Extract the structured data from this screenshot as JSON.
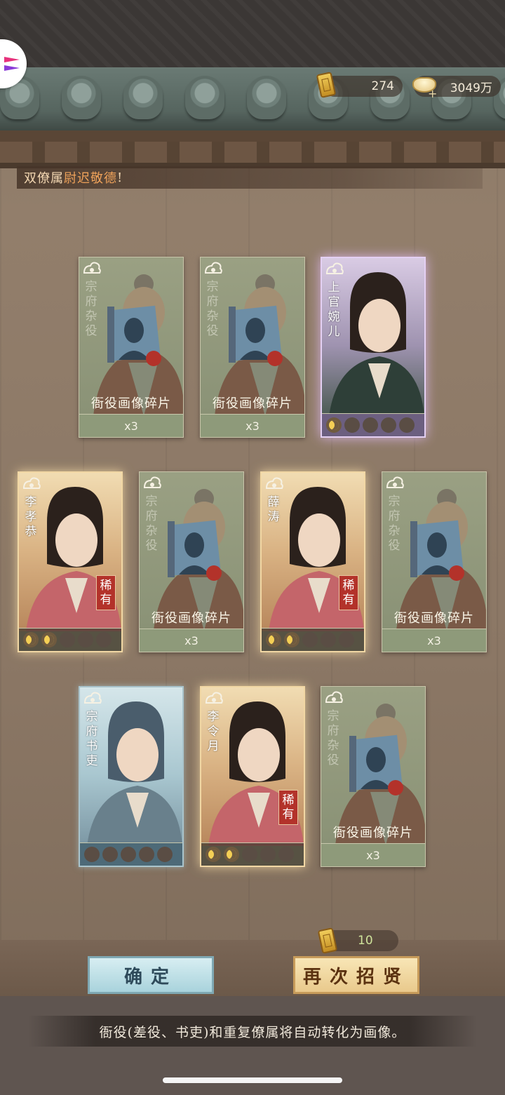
{
  "banner": {
    "prefix": "双僚属",
    "highlight": "尉迟敬德",
    "suffix": "!"
  },
  "currency": {
    "tokens": "274",
    "silver": "3049万"
  },
  "cards": [
    {
      "type": "fragment",
      "side_name": "宗府杂役",
      "label": "衙役画像碎片",
      "qty": "x3"
    },
    {
      "type": "fragment",
      "side_name": "宗府杂役",
      "label": "衙役画像碎片",
      "qty": "x3"
    },
    {
      "type": "character",
      "name": "上官婉儿",
      "rarity": "",
      "stars_lit": 1,
      "stars_total": 5,
      "frame": "purple"
    },
    {
      "type": "character",
      "name": "李孝恭",
      "rarity": "稀有",
      "stars_lit": 2,
      "stars_total": 5,
      "frame": "gold"
    },
    {
      "type": "fragment",
      "side_name": "宗府杂役",
      "label": "衙役画像碎片",
      "qty": "x3"
    },
    {
      "type": "character",
      "name": "薛涛",
      "rarity": "稀有",
      "stars_lit": 2,
      "stars_total": 5,
      "frame": "gold"
    },
    {
      "type": "fragment",
      "side_name": "宗府杂役",
      "label": "衙役画像碎片",
      "qty": "x3"
    },
    {
      "type": "character",
      "name": "宗府书吏",
      "rarity": "",
      "stars_lit": 0,
      "stars_total": 5,
      "frame": "blue"
    },
    {
      "type": "character",
      "name": "李令月",
      "rarity": "稀有",
      "stars_lit": 2,
      "stars_total": 5,
      "frame": "gold"
    },
    {
      "type": "fragment",
      "side_name": "宗府杂役",
      "label": "衙役画像碎片",
      "qty": "x3"
    }
  ],
  "recruit_cost": "10",
  "buttons": {
    "confirm": "确定",
    "again": "再次招贤"
  },
  "footer_note": "衙役(差役、书吏)和重复僚属将自动转化为画像。",
  "colors": {
    "highlight": "#f0a35a",
    "rare_badge": "#b3322a",
    "star": "#f4cf55"
  },
  "icons": {
    "token": "token-icon",
    "silver": "silver-ingot-icon",
    "seal": "cloud-seal-icon",
    "star": "moon-star-icon"
  }
}
